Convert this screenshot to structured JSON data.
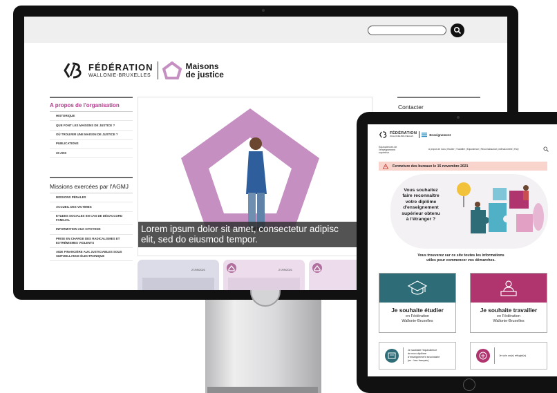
{
  "desktop_site": {
    "logo": {
      "line1": "FÉDÉRATION",
      "line2": "WALLONIE-BRUXELLES",
      "mj_line1": "Maisons",
      "mj_line2": "de justice"
    },
    "sidebar": {
      "section1": {
        "title": "A propos de l'organisation",
        "items": [
          "HISTORIQUE",
          "QUE FONT LES MAISONS DE JUSTICE ?",
          "OÙ TROUVER UNE MAISON DE JUSTICE ?",
          "PUBLICATIONS",
          "30 ANS"
        ]
      },
      "section2": {
        "title": "Missions exercées par l'AGMJ",
        "items": [
          "MISSIONS PÉNALES",
          "ACCUEIL DES VICTIMES",
          "ETUDES SOCIALES EN CAS DE DÉSACCORD FAMILIAL",
          "INFORMATION AUX CITOYENS",
          "PRISE EN CHARGE DES RADICALISMES ET EXTRÉMISMES VIOLENTS",
          "AIDE FINANCIÈRE AUX JUSTICIABLES SOUS SURVEILLANCE ÉLECTRONIQUE"
        ]
      }
    },
    "hero_caption_line1": "Lorem ipsum dolor sit amet, consectetur adipisc",
    "hero_caption_line2": "elit, sed do eiusmod tempor.",
    "cards": [
      {
        "date": "27/09/2021"
      },
      {
        "date": "27/09/2021"
      }
    ],
    "contact_label": "Contacter"
  },
  "tablet_site": {
    "logo": {
      "line1": "FÉDÉRATION",
      "line2": "WALLONIE-BRUXELLES",
      "section": "Enseignement"
    },
    "subtitle": [
      "Equivalences de",
      "l'enseignement",
      "supérieur"
    ],
    "nav": "A propos de nous | Etudier | Travailler | Equivalence | Reconnaissance professionnelle | FAQ",
    "alert": "Fermeture des bureaux le 15 novembre 2021",
    "hero_question": [
      "Vous souhaitez",
      "faire reconnaître",
      "votre diplôme",
      "d'enseignement",
      "supérieur obtenu",
      "à l'étranger ?"
    ],
    "info": [
      "Vous trouverez sur ce site toutes les informations",
      "utiles pour commencer vos démarches."
    ],
    "cards": [
      {
        "title": "Je souhaite étudier",
        "sub1": "en Fédération",
        "sub2": "Wallonie-Bruxelles"
      },
      {
        "title": "Je souhaite travailler",
        "sub1": "en Fédération",
        "sub2": "Wallonie-Bruxelles"
      }
    ],
    "mini_cards": [
      {
        "lines": [
          "Je souhaite l'équivalence",
          "de mon diplôme",
          "d'enseignement secondaire",
          "(ex : bac français)"
        ]
      },
      {
        "lines": [
          "Je suis un(e) réfugié(e)"
        ]
      }
    ]
  },
  "colors": {
    "accent_pink": "#b03a8a",
    "teal": "#2e6d78",
    "magenta": "#b0356f",
    "hero_purple": "#c58fc2"
  }
}
